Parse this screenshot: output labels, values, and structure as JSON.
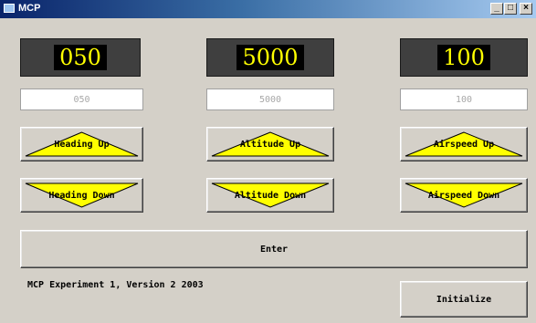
{
  "window": {
    "title": "MCP",
    "controls": {
      "minimize": "_",
      "maximize": "□",
      "close": "×"
    }
  },
  "displays": {
    "heading": "050",
    "altitude": "5000",
    "airspeed": "100"
  },
  "fields": {
    "heading": {
      "value": "050"
    },
    "altitude": {
      "value": "5000"
    },
    "airspeed": {
      "value": "100"
    }
  },
  "buttons": {
    "heading_up": "Heading Up",
    "altitude_up": "Altitude Up",
    "airspeed_up": "Airspeed Up",
    "heading_down": "Heading Down",
    "altitude_down": "Altitude Down",
    "airspeed_down": "Airspeed Down",
    "enter": "Enter",
    "initialize": "Initialize"
  },
  "footer": {
    "caption": "MCP Experiment 1, Version 2  2003"
  },
  "colors": {
    "display_bg": "#3f3f3f",
    "display_text": "#ffff00",
    "arrow_fill": "#ffff00",
    "window_bg": "#d4d0c8"
  },
  "icons": {
    "up_arrow": "triangle-up-icon",
    "down_arrow": "triangle-down-icon"
  }
}
